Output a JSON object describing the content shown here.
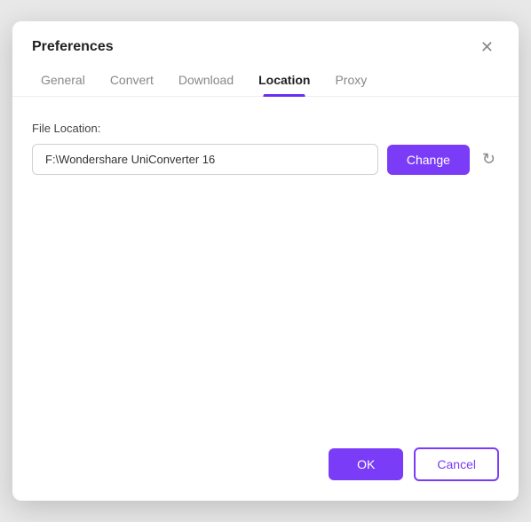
{
  "dialog": {
    "title": "Preferences",
    "close_label": "✕"
  },
  "tabs": {
    "items": [
      {
        "id": "general",
        "label": "General",
        "active": false
      },
      {
        "id": "convert",
        "label": "Convert",
        "active": false
      },
      {
        "id": "download",
        "label": "Download",
        "active": false
      },
      {
        "id": "location",
        "label": "Location",
        "active": true
      },
      {
        "id": "proxy",
        "label": "Proxy",
        "active": false
      }
    ]
  },
  "body": {
    "file_location_label": "File Location:",
    "file_location_value": "F:\\Wondershare UniConverter 16",
    "change_button_label": "Change"
  },
  "footer": {
    "ok_label": "OK",
    "cancel_label": "Cancel"
  },
  "icons": {
    "refresh": "↻",
    "close": "✕"
  }
}
